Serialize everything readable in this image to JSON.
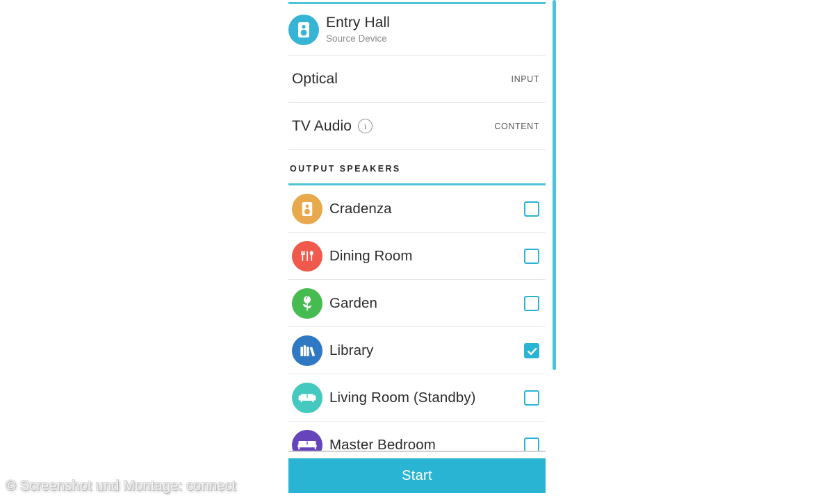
{
  "panel": {
    "accent_color": "#29b4d4",
    "rule_color": "#4cc3d9"
  },
  "source": {
    "icon": "speaker-icon",
    "icon_color": "#35b4d6",
    "name": "Entry Hall",
    "subtitle": "Source Device"
  },
  "rows": [
    {
      "label": "Optical",
      "tag": "INPUT",
      "has_info_icon": false
    },
    {
      "label": "TV Audio",
      "tag": "CONTENT",
      "has_info_icon": true,
      "info_icon": "info-circle-icon"
    }
  ],
  "section": {
    "title": "OUTPUT SPEAKERS"
  },
  "speakers": [
    {
      "name": "Cradenza",
      "icon": "speaker-icon",
      "icon_color": "#e8a84c",
      "checked": false
    },
    {
      "name": "Dining Room",
      "icon": "cutlery-icon",
      "icon_color": "#ef5a4c",
      "checked": false
    },
    {
      "name": "Garden",
      "icon": "flower-icon",
      "icon_color": "#46bb50",
      "checked": false
    },
    {
      "name": "Library",
      "icon": "books-icon",
      "icon_color": "#2f78c4",
      "checked": true
    },
    {
      "name": "Living Room (Standby)",
      "icon": "sofa-icon",
      "icon_color": "#44c8c0",
      "checked": false
    },
    {
      "name": "Master Bedroom",
      "icon": "bed-icon",
      "icon_color": "#6645bc",
      "checked": false
    }
  ],
  "footer": {
    "start_label": "Start"
  },
  "watermark": {
    "text": "© Screenshot und Montage: connect"
  }
}
